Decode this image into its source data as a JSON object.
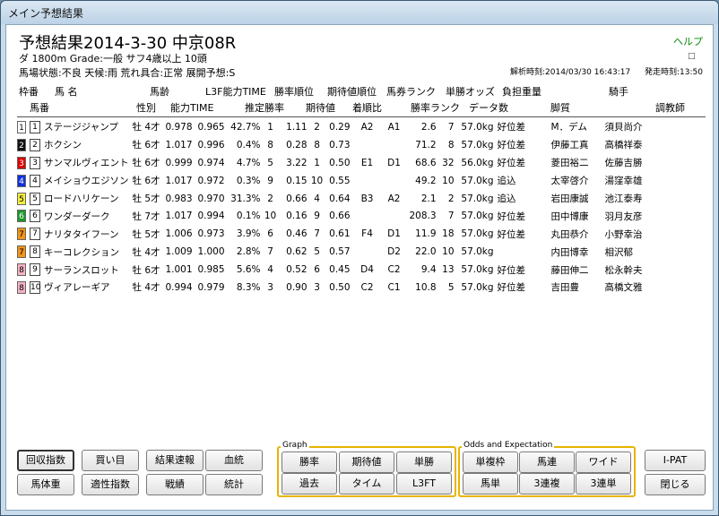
{
  "window": {
    "title": "メイン予想結果"
  },
  "header": {
    "race_title": "予想結果2014-3-30 中京08R",
    "help": "ヘルプ",
    "cond_line1": "ダ 1800m  Grade:一般  サフ4歳以上  10頭",
    "cond_line2": "馬場状態:不良   天候:雨   荒れ具合:正常   展開予想:S",
    "analysis_time": "解析時刻:2014/03/30 16:43:17",
    "post_time": "発走時刻:13:50",
    "small_icon": "□"
  },
  "columns": {
    "row1": [
      "枠番",
      "馬 名",
      "馬齢",
      "L3F能力TIME",
      "勝率順位",
      "期待値順位",
      "馬券ランク",
      "単勝オッズ",
      "負担重量",
      "騎手"
    ],
    "row2": [
      "馬番",
      "性別",
      "能力TIME",
      "推定勝率",
      "期待値",
      "着順比",
      "勝率ランク",
      "データ数",
      "脚質",
      "調教師"
    ]
  },
  "entries": [
    {
      "waku": "1",
      "num": "1",
      "name": "ステージジャンプ",
      "sex": "牡 4才",
      "time": "0.978",
      "l3f": "0.965",
      "win": "42.7%",
      "win_rank": "1",
      "ev": "1.11",
      "ev_rank": "2",
      "ratio": "0.29",
      "ticket": "A2",
      "winr": "A1",
      "odds": "2.6",
      "data": "7",
      "weight": "57.0kg",
      "style": "好位差",
      "jockey": "M．デム",
      "trainer": "須貝尚介",
      "color": "#ffffff",
      "text": "#000000"
    },
    {
      "waku": "2",
      "num": "2",
      "name": "ホクシン",
      "sex": "牡 6才",
      "time": "1.017",
      "l3f": "0.996",
      "win": "0.4%",
      "win_rank": "8",
      "ev": "0.28",
      "ev_rank": "8",
      "ratio": "0.73",
      "ticket": "",
      "winr": "",
      "odds": "71.2",
      "data": "8",
      "weight": "57.0kg",
      "style": "好位差",
      "jockey": "伊藤工真",
      "trainer": "高橋祥泰",
      "color": "#111111",
      "text": "#ffffff"
    },
    {
      "waku": "3",
      "num": "3",
      "name": "サンマルヴィエント",
      "sex": "牡 6才",
      "time": "0.999",
      "l3f": "0.974",
      "win": "4.7%",
      "win_rank": "5",
      "ev": "3.22",
      "ev_rank": "1",
      "ratio": "0.50",
      "ticket": "E1",
      "winr": "D1",
      "odds": "68.6",
      "data": "32",
      "weight": "56.0kg",
      "style": "好位差",
      "jockey": "菱田裕二",
      "trainer": "佐藤吉勝",
      "color": "#e00000",
      "text": "#ffffff"
    },
    {
      "waku": "4",
      "num": "4",
      "name": "メイショウエジソン",
      "sex": "牡 6才",
      "time": "1.017",
      "l3f": "0.972",
      "win": "0.3%",
      "win_rank": "9",
      "ev": "0.15",
      "ev_rank": "10",
      "ratio": "0.55",
      "ticket": "",
      "winr": "",
      "odds": "49.2",
      "data": "10",
      "weight": "57.0kg",
      "style": "追込",
      "jockey": "太宰啓介",
      "trainer": "湯窪幸雄",
      "color": "#1030e0",
      "text": "#ffffff"
    },
    {
      "waku": "5",
      "num": "5",
      "name": "ロードハリケーン",
      "sex": "牡 5才",
      "time": "0.983",
      "l3f": "0.970",
      "win": "31.3%",
      "win_rank": "2",
      "ev": "0.66",
      "ev_rank": "4",
      "ratio": "0.64",
      "ticket": "B3",
      "winr": "A2",
      "odds": "2.1",
      "data": "2",
      "weight": "57.0kg",
      "style": "追込",
      "jockey": "岩田康誠",
      "trainer": "池江泰寿",
      "color": "#f6ef3a",
      "text": "#000000"
    },
    {
      "waku": "6",
      "num": "6",
      "name": "ワンダーダーク",
      "sex": "牡 7才",
      "time": "1.017",
      "l3f": "0.994",
      "win": "0.1%",
      "win_rank": "10",
      "ev": "0.16",
      "ev_rank": "9",
      "ratio": "0.66",
      "ticket": "",
      "winr": "",
      "odds": "208.3",
      "data": "7",
      "weight": "57.0kg",
      "style": "好位差",
      "jockey": "田中博康",
      "trainer": "羽月友彦",
      "color": "#1a9a2a",
      "text": "#ffffff"
    },
    {
      "waku": "7",
      "num": "7",
      "name": "ナリタタイフーン",
      "sex": "牡 5才",
      "time": "1.006",
      "l3f": "0.973",
      "win": "3.9%",
      "win_rank": "6",
      "ev": "0.46",
      "ev_rank": "7",
      "ratio": "0.61",
      "ticket": "F4",
      "winr": "D1",
      "odds": "11.9",
      "data": "18",
      "weight": "57.0kg",
      "style": "好位差",
      "jockey": "丸田恭介",
      "trainer": "小野幸治",
      "color": "#f29418",
      "text": "#000000"
    },
    {
      "waku": "7",
      "num": "8",
      "name": "キーコレクション",
      "sex": "牡 4才",
      "time": "1.009",
      "l3f": "1.000",
      "win": "2.8%",
      "win_rank": "7",
      "ev": "0.62",
      "ev_rank": "5",
      "ratio": "0.57",
      "ticket": "",
      "winr": "D2",
      "odds": "22.0",
      "data": "10",
      "weight": "57.0kg",
      "style": "",
      "jockey": "内田博幸",
      "trainer": "相沢郁",
      "color": "#f29418",
      "text": "#000000"
    },
    {
      "waku": "8",
      "num": "9",
      "name": "サーランスロット",
      "sex": "牡 6才",
      "time": "1.001",
      "l3f": "0.985",
      "win": "5.6%",
      "win_rank": "4",
      "ev": "0.52",
      "ev_rank": "6",
      "ratio": "0.45",
      "ticket": "D4",
      "winr": "C2",
      "odds": "9.4",
      "data": "13",
      "weight": "57.0kg",
      "style": "好位差",
      "jockey": "藤田伸二",
      "trainer": "松永幹夫",
      "color": "#f6b2c2",
      "text": "#000000"
    },
    {
      "waku": "8",
      "num": "10",
      "name": "ヴィアレーギア",
      "sex": "牡 4才",
      "time": "0.994",
      "l3f": "0.979",
      "win": "8.3%",
      "win_rank": "3",
      "ev": "0.90",
      "ev_rank": "3",
      "ratio": "0.50",
      "ticket": "C2",
      "winr": "C1",
      "odds": "10.8",
      "data": "5",
      "weight": "57.0kg",
      "style": "好位差",
      "jockey": "吉田豊",
      "trainer": "高橋文雅",
      "color": "#f6b2c2",
      "text": "#000000"
    }
  ],
  "buttons": {
    "left": [
      "回収指数",
      "買い目",
      "結果速報",
      "血統",
      "馬体重",
      "適性指数",
      "戦績",
      "統計"
    ],
    "graph_label": "Graph",
    "graph": [
      "勝率",
      "期待値",
      "単勝",
      "過去",
      "タイム",
      "L3FT"
    ],
    "odds_label": "Odds and Expectation",
    "odds": [
      "単複枠",
      "馬連",
      "ワイド",
      "馬単",
      "3連複",
      "3連単"
    ],
    "right": [
      "I-PAT",
      "閉じる"
    ]
  }
}
